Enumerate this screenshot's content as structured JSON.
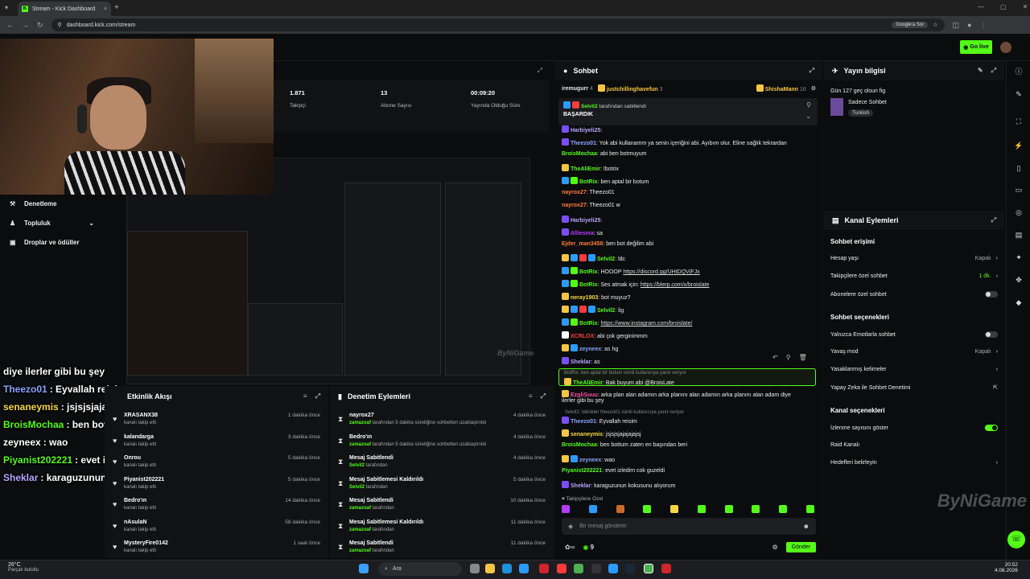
{
  "browser": {
    "tab_title": "Stream - Kick Dashboard",
    "url": "dashboard.kick.com/stream",
    "search_chip": "Google'a Sor"
  },
  "topbar": {
    "go_live": "Go live"
  },
  "stats": [
    {
      "value": "1.871",
      "label": "Takipçi"
    },
    {
      "value": "13",
      "label": "Abone Sayısı"
    },
    {
      "value": "00:09:20",
      "label": "Yayında Olduğu Süre"
    }
  ],
  "left_nav": {
    "items": [
      "Denetleme",
      "Topluluk",
      "Droplar ve ödüller"
    ]
  },
  "overlay_chat": [
    {
      "user": "",
      "text": "diye ilerler gibi bu şey",
      "color": "#ffffff"
    },
    {
      "user": "Theezo01",
      "text": ": Eyvallah reisim",
      "color": "#8aa4ff"
    },
    {
      "user": "senaneymis",
      "text": ": jsjsjsjajajajajsj",
      "color": "#f5d742"
    },
    {
      "user": "BroisMochaa",
      "text": ": ben bottum zaten en başından beri",
      "color": "#53fc18"
    },
    {
      "user": "zeyneex",
      "text": ": wao",
      "color": "#ffffff"
    },
    {
      "user": "Piyanist202221",
      "text": ": evet izledim cok guzeldi",
      "color": "#53fc18"
    },
    {
      "user": "Sheklar",
      "text": ": karaguzunun kokusunu alıyorum",
      "color": "#b9a4ff"
    }
  ],
  "activity": {
    "title": "Etkinlik Akışı",
    "items": [
      {
        "name": "XRASANX38",
        "sub": "kanalı takip etti",
        "time": "1 dakika önce"
      },
      {
        "name": "kalandarga",
        "sub": "kanalı takip etti",
        "time": "3 dakika önce"
      },
      {
        "name": "Onrou",
        "sub": "kanalı takip etti",
        "time": "5 dakika önce"
      },
      {
        "name": "Piyanist202221",
        "sub": "kanalı takip etti",
        "time": "5 dakika önce"
      },
      {
        "name": "Bedro'ın",
        "sub": "kanalı takip etti",
        "time": "14 dakika önce"
      },
      {
        "name": "nAsulaN",
        "sub": "kanalı takip etti",
        "time": "58 dakika önce"
      },
      {
        "name": "MysteryFire0142",
        "sub": "kanalı takip etti",
        "time": "1 saat önce"
      }
    ]
  },
  "moderation": {
    "title": "Denetim Eylemleri",
    "items": [
      {
        "name": "nayrox27",
        "by": "zamazoaf",
        "sub": "tarafından 5 dakika süreliğine sohbetten uzaklaştırıldı",
        "time": "4 dakika önce"
      },
      {
        "name": "Bedro'ın",
        "by": "zamazoaf",
        "sub": "tarafından 5 dakika süreliğine sohbetten uzaklaştırıldı",
        "time": "4 dakika önce"
      },
      {
        "name": "Mesaj Sabitlendi",
        "by": "Selvil2",
        "sub": "tarafından",
        "time": "4 dakika önce"
      },
      {
        "name": "Mesaj Sabitlemesi Kaldırıldı",
        "by": "Selvil2",
        "sub": "tarafından",
        "time": "5 dakika önce"
      },
      {
        "name": "Mesaj Sabitlendi",
        "by": "zamazoaf",
        "sub": "tarafından",
        "time": "10 dakika önce"
      },
      {
        "name": "Mesaj Sabitlemesi Kaldırıldı",
        "by": "zamazoaf",
        "sub": "tarafından",
        "time": "11 dakika önce"
      },
      {
        "name": "Mesaj Sabitlendi",
        "by": "zamazoaf",
        "sub": "tarafından",
        "time": "11 dakika önce"
      }
    ]
  },
  "chat": {
    "title": "Sohbet",
    "top_users": [
      {
        "name": "iremugurr",
        "count": "4"
      },
      {
        "name": "justchillinghavefun",
        "count": "3"
      },
      {
        "name": "ShishaMann",
        "count": "16"
      }
    ],
    "pinned_by": "Selvil2",
    "pinned_suffix": "tarafından sabitlendi",
    "pinned_text": "BAŞARDIK",
    "messages": [
      {
        "user": "Harbiyeli25",
        "text": ":",
        "color": "#b9a4ff",
        "badges": [
          "#7a4dff"
        ]
      },
      {
        "user": "Theezo01",
        "text": ": Yok abi kullanamm ya senin içeriğini abi. Ayıbım olur. Eline sağlık tekrardan",
        "color": "#8aa4ff",
        "badges": [
          "#7a4dff"
        ]
      },
      {
        "user": "BroisMochaa",
        "text": ": abi ben botmuyum",
        "color": "#53fc18",
        "badges": []
      },
      {
        "user": "TheAliEmir",
        "text": ": !botrix",
        "color": "#53fc18",
        "badges": [
          "#f5c542"
        ]
      },
      {
        "user": "BotRix",
        "text": ": ben aptal bir botum",
        "color": "#53fc18",
        "badges": [
          "#2b9bff",
          "#53fc18"
        ]
      },
      {
        "user": "nayrox27",
        "text": ": Theezo01",
        "color": "#ff7b3a",
        "badges": []
      },
      {
        "user": "nayrox27",
        "text": ": Theezo01 w",
        "color": "#ff7b3a",
        "badges": []
      },
      {
        "user": "Harbiyeli25",
        "text": ":",
        "color": "#b9a4ff",
        "badges": [
          "#7a4dff"
        ]
      },
      {
        "user": "Alliesma",
        "text": ": sa",
        "color": "#b33bff",
        "badges": [
          "#7a4dff"
        ]
      },
      {
        "user": "Ejder_man3458",
        "text": ": ben bot değilim abi",
        "color": "#ff7b3a",
        "badges": []
      },
      {
        "user": "Selvil2",
        "text": ": ldc",
        "color": "#53fc18",
        "badges": [
          "#f5c542",
          "#2b9bff",
          "#ff3b3b",
          "#2b9bff"
        ]
      },
      {
        "user": "BotRix",
        "text": ": HOOOP ",
        "link": "https://discord.gg/UHtDQVjFJx",
        "color": "#53fc18",
        "badges": [
          "#2b9bff",
          "#53fc18"
        ]
      },
      {
        "user": "BotRix",
        "text": ": Ses atmak için: ",
        "link": "https://blerp.com/x/broislate",
        "color": "#53fc18",
        "badges": [
          "#2b9bff",
          "#53fc18"
        ]
      },
      {
        "user": "neray1903",
        "text": ": bot muyuz?",
        "color": "#f5d742",
        "badges": [
          "#f5c542"
        ]
      },
      {
        "user": "Selvil2",
        "text": ": lig",
        "color": "#53fc18",
        "badges": [
          "#f5c542",
          "#2b9bff",
          "#ff3b3b",
          "#2b9bff"
        ]
      },
      {
        "user": "BotRix",
        "text": ": ",
        "link": "https://www.instagram.com/broislate/",
        "color": "#53fc18",
        "badges": [
          "#2b9bff",
          "#53fc18"
        ]
      },
      {
        "user": "XCRLOX",
        "text": ": abi çok gerginimmm",
        "color": "#ff3b3b",
        "badges": [
          "#ffffff"
        ]
      },
      {
        "user": "zeyneex",
        "text": ": as hg",
        "color": "#8aa4ff",
        "badges": [
          "#f5c542",
          "#2b9bff"
        ]
      },
      {
        "user": "Sheklar",
        "text": ": as",
        "color": "#b9a4ff",
        "badges": [
          "#7a4dff"
        ]
      }
    ],
    "reply1_ctx": "BotRix: ben aptal bir botum isimli kullanıcıya yanıt veriyor",
    "reply1_user": "TheAliEmir",
    "reply1_text": ": Bak buyum abi @BroisLate",
    "msg_long_user": "EzgliSuuu",
    "msg_long_text": ": arka plan alan adamın arka planını alan adamın arka planını alan adam diye",
    "msg_long_text2": "ilerler gibi bu şey",
    "reply2_ctx": "Selvil2: tebrikler theezo01 isimli kullanıcıya yanıt veriyor",
    "messages2": [
      {
        "user": "Theezo01",
        "text": ": Eyvallah reisim",
        "color": "#8aa4ff",
        "badges": [
          "#7a4dff"
        ]
      },
      {
        "user": "senaneymis",
        "text": ": jsjsjsjajajajajsj",
        "color": "#f5d742",
        "badges": [
          "#f5c542"
        ]
      },
      {
        "user": "BroisMochaa",
        "text": ": ben bottum zaten en başından beri",
        "color": "#53fc18",
        "badges": []
      },
      {
        "user": "zeyneex",
        "text": ": wao",
        "color": "#8aa4ff",
        "badges": [
          "#f5c542",
          "#2b9bff"
        ]
      },
      {
        "user": "Piyanist202221",
        "text": ": evet izledim cok guzeldi",
        "color": "#53fc18",
        "badges": []
      },
      {
        "user": "Sheklar",
        "text": ": karaguzunun kokusunu alıyorum",
        "color": "#b9a4ff",
        "badges": [
          "#7a4dff"
        ]
      }
    ],
    "followers_label": "Takipçilere Özel",
    "input_placeholder": "Bir mesaj gönderin",
    "points": "9",
    "send_label": "Gönder"
  },
  "stream_info": {
    "title": "Yayın bilgisi",
    "stream_title": "Gün 127 geç olsun fig",
    "category": "Sadece Sohbet",
    "tag": "Turkish"
  },
  "channel_actions": {
    "title": "Kanal Eylemleri",
    "sections": [
      {
        "heading": "Sohbet erişimi",
        "rows": [
          {
            "label": "Hesap yaşı",
            "value": "Kapalı",
            "kind": "arrow"
          },
          {
            "label": "Takipçilere özel sohbet",
            "value": "1 dk.",
            "kind": "arrow-green"
          },
          {
            "label": "Abonelere özel sohbet",
            "value": "",
            "kind": "toggle-off"
          }
        ]
      },
      {
        "heading": "Sohbet seçenekleri",
        "rows": [
          {
            "label": "Yalnızca Emotlarla sohbet",
            "value": "",
            "kind": "toggle-off"
          },
          {
            "label": "Yavaş mod",
            "value": "Kapalı",
            "kind": "arrow"
          },
          {
            "label": "Yasaklanmış kelimeler",
            "value": "",
            "kind": "arrow"
          },
          {
            "label": "Yapay Zeka ile Sohbet Denetimi",
            "value": "",
            "kind": "ext"
          }
        ]
      },
      {
        "heading": "Kanal seçenekleri",
        "rows": [
          {
            "label": "İzlenme sayısını göster",
            "value": "",
            "kind": "toggle-on"
          },
          {
            "label": "Raid Kanalı",
            "value": "",
            "kind": "none"
          },
          {
            "label": "Hedefleri belirleyin",
            "value": "",
            "kind": "arrow"
          }
        ]
      }
    ]
  },
  "taskbar": {
    "weather_temp": "26°C",
    "weather_desc": "Parçalı bulutlu",
    "search": "Ara",
    "time": "20:52",
    "date": "4.08.2026"
  },
  "watermark": "ByNiGame",
  "colors": {
    "accent": "#53fc18",
    "bg": "#0b0c0d",
    "panel": "#111214"
  }
}
